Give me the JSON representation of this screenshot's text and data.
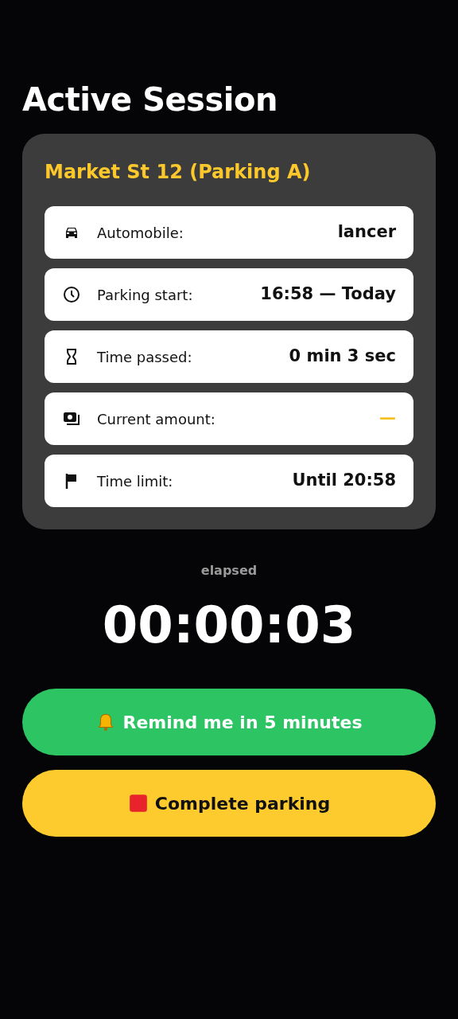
{
  "title": "Active Session",
  "session": {
    "location": "Market St 12 (Parking A)",
    "rows": [
      {
        "kind": "car",
        "label": "Automobile:",
        "value": "lancer",
        "highlighted": false
      },
      {
        "kind": "clock",
        "label": "Parking start:",
        "value": "16:58 — Today",
        "highlighted": false
      },
      {
        "kind": "hourglass",
        "label": "Time passed:",
        "value": "0 min 3 sec",
        "highlighted": false
      },
      {
        "kind": "money",
        "label": "Current amount:",
        "value": "—",
        "highlighted": true
      },
      {
        "kind": "flag",
        "label": "Time limit:",
        "value": "Until 20:58",
        "highlighted": false
      }
    ]
  },
  "timer": {
    "caption": "elapsed",
    "value": "00:00:03"
  },
  "buttons": [
    {
      "kind": "remind",
      "label": "Remind me in 5 minutes"
    },
    {
      "kind": "complete",
      "label": "Complete parking"
    }
  ]
}
